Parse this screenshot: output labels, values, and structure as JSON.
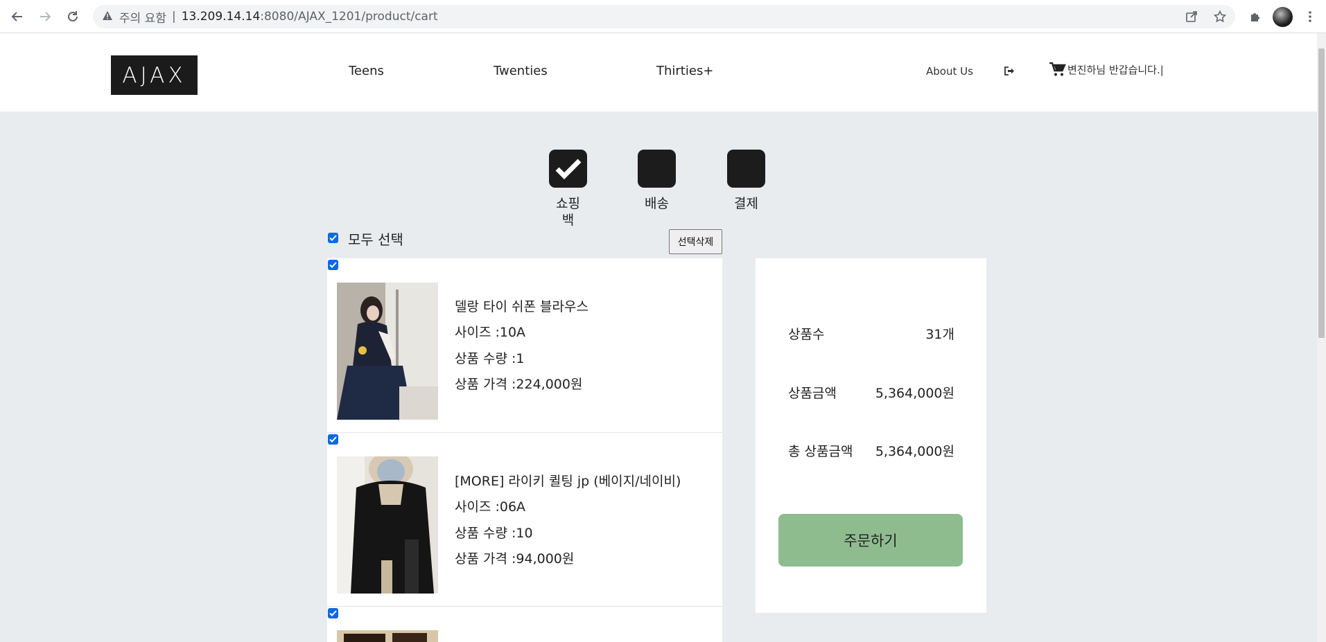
{
  "browser": {
    "warning_text": "주의 요함",
    "url_host": "13.209.14.14",
    "url_path": ":8080/AJAX_1201/product/cart"
  },
  "header": {
    "logo_text": "AJAX",
    "nav": [
      "Teens",
      "Twenties",
      "Thirties+"
    ],
    "about": "About Us",
    "greeting": "변진하님 반갑습니다.|"
  },
  "steps": [
    {
      "label": "쇼핑\n백",
      "done": true
    },
    {
      "label": "배송",
      "done": false
    },
    {
      "label": "결제",
      "done": false
    }
  ],
  "cart": {
    "select_all_label": "모두 선택",
    "delete_selected_label": "선택삭제",
    "items": [
      {
        "name": "델랑 타이 쉬폰 블라우스",
        "size": "사이즈 :10A",
        "qty": "상품 수량 :1",
        "price": "상품 가격 :224,000원",
        "checked": true
      },
      {
        "name": "[MORE] 라이키 퀼팅 jp (베이지/네이비)",
        "size": "사이즈 :06A",
        "qty": "상품 수량 :10",
        "price": "상품 가격 :94,000원",
        "checked": true
      },
      {
        "name": "",
        "size": "",
        "qty": "",
        "price": "",
        "checked": true
      }
    ]
  },
  "summary": {
    "count_label": "상품수",
    "count_value": "31개",
    "amount_label": "상품금액",
    "amount_value": "5,364,000원",
    "total_label": "총 상품금액",
    "total_value": "5,364,000원",
    "order_button": "주문하기",
    "order_button_color": "#8fbc8f"
  }
}
